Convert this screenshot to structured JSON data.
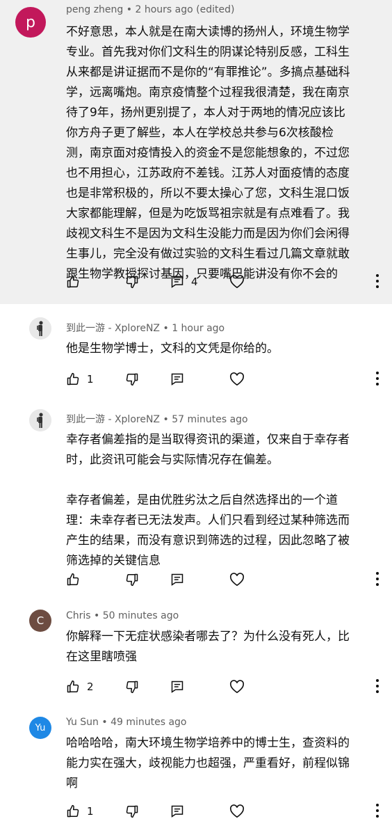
{
  "colors": {
    "avatar_p": "#c2185b",
    "avatar_c": "#6d4c41",
    "avatar_yu": "#1e88e5",
    "highlight_bg": "#f0f0f0"
  },
  "comments": [
    {
      "avatar_letter": "p",
      "author": "peng zheng",
      "time": "2 hours ago (edited)",
      "text": "不好意思，本人就是在南大读博的扬州人，环境生物学\n专业。首先我对你们文科生的阴谋论特别反感，工科生\n从来都是讲证据而不是你的“有罪推论”。多搞点基础科\n学，远离嘴炮。南京疫情整个过程我很清楚，我在南京\n待了9年，扬州更别提了，本人对于两地的情况应该比\n你方舟子更了解些，本人在学校总共参与6次核酸检\n测，南京面对疫情投入的资金不是您能想象的，不过您\n也不用担心，江苏政府不差钱。江苏人对面疫情的态度\n也是非常积极的，所以不要太操心了您，文科生混口饭\n大家都能理解，但是为吃饭骂祖宗就是有点难看了。我\n歧视文科生不是因为文科生没能力而是因为你们会闲得\n生事儿，完全没有做过实验的文科生看过几篇文章就敢\n跟生物学教授探讨基因，只要嘴巴能讲没有你不会的",
      "like_count": "",
      "reply_count": "4"
    },
    {
      "author": "到此一游 - XploreNZ",
      "time": "1 hour ago",
      "text": "他是生物学博士，文科的文凭是你给的。",
      "like_count": "1",
      "reply_count": ""
    },
    {
      "author": "到此一游 - XploreNZ",
      "time": "57 minutes ago",
      "text": "幸存者偏差指的是当取得资讯的渠道，仅来自于幸存者\n时，此资讯可能会与实际情况存在偏差。\n\n幸存者偏差，是由优胜劣汰之后自然选择出的一个道\n理：未幸存者已无法发声。人们只看到经过某种筛选而\n产生的结果，而没有意识到筛选的过程，因此忽略了被\n筛选掉的关键信息",
      "like_count": "",
      "reply_count": ""
    },
    {
      "avatar_letter": "C",
      "author": "Chris",
      "time": "50 minutes ago",
      "text": "你解释一下无症状感染者哪去了？为什么没有死人，比\n在这里瞎喷强",
      "like_count": "2",
      "reply_count": ""
    },
    {
      "avatar_letter": "Yu",
      "author": "Yu Sun",
      "time": "49 minutes ago",
      "text": "哈哈哈哈，南大环境生物学培养中的博士生，查资料的\n能力实在强大，歧视能力也超强，严重看好，前程似锦\n啊",
      "like_count": "1",
      "reply_count": ""
    }
  ]
}
